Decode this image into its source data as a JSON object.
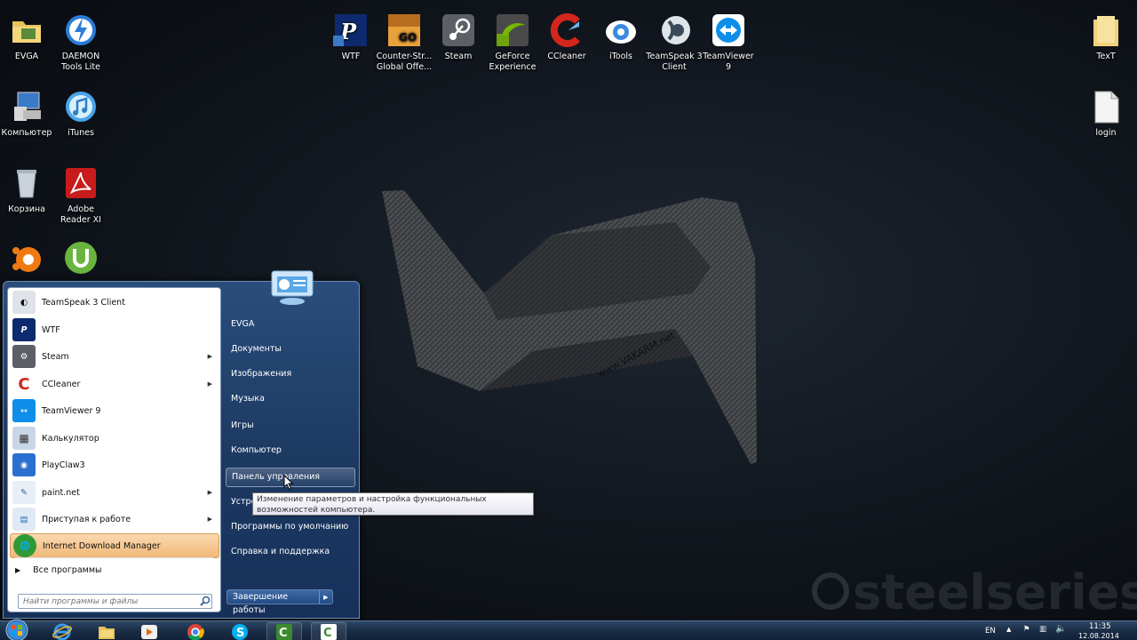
{
  "desktop_icons": [
    {
      "label": "EVGA",
      "icon": "folder-icon"
    },
    {
      "label": "DAEMON Tools Lite",
      "icon": "daemon-tools-icon"
    },
    {
      "label": "Компьютер",
      "icon": "computer-icon"
    },
    {
      "label": "iTunes",
      "icon": "itunes-icon"
    },
    {
      "label": "Корзина",
      "icon": "recycle-bin-icon"
    },
    {
      "label": "Adobe Reader XI",
      "icon": "adobe-reader-icon"
    },
    {
      "label": "WTF",
      "icon": "playclaw-icon"
    },
    {
      "label": "Counter-Str... Global Offe...",
      "icon": "csgo-icon"
    },
    {
      "label": "Steam",
      "icon": "steam-icon"
    },
    {
      "label": "GeForce Experience",
      "icon": "geforce-icon"
    },
    {
      "label": "CCleaner",
      "icon": "ccleaner-icon"
    },
    {
      "label": "iTools",
      "icon": "itools-icon"
    },
    {
      "label": "TeamSpeak 3 Client",
      "icon": "teamspeak-icon"
    },
    {
      "label": "TeamViewer 9",
      "icon": "teamviewer-icon"
    },
    {
      "label": "TexT",
      "icon": "folder-icon"
    },
    {
      "label": "login",
      "icon": "text-file-icon"
    }
  ],
  "start_menu": {
    "programs": [
      {
        "label": "TeamSpeak 3 Client",
        "icon": "teamspeak-icon",
        "has_submenu": false
      },
      {
        "label": "WTF",
        "icon": "playclaw-icon",
        "has_submenu": false
      },
      {
        "label": "Steam",
        "icon": "steam-icon",
        "has_submenu": true
      },
      {
        "label": "CCleaner",
        "icon": "ccleaner-icon",
        "has_submenu": true
      },
      {
        "label": "TeamViewer 9",
        "icon": "teamviewer-icon",
        "has_submenu": false
      },
      {
        "label": "Калькулятор",
        "icon": "calculator-icon",
        "has_submenu": false
      },
      {
        "label": "PlayClaw3",
        "icon": "playclaw3-icon",
        "has_submenu": false
      },
      {
        "label": "paint.net",
        "icon": "paintnet-icon",
        "has_submenu": true
      },
      {
        "label": "Приступая к работе",
        "icon": "getting-started-icon",
        "has_submenu": true
      },
      {
        "label": "Internet Download Manager",
        "icon": "idm-icon",
        "has_submenu": false
      }
    ],
    "all_programs": "Все программы",
    "search_placeholder": "Найти программы и файлы",
    "right_items": [
      {
        "label": "EVGA"
      },
      {
        "label": "Документы"
      },
      {
        "label": "Изображения"
      },
      {
        "label": "Музыка"
      },
      {
        "label": "Игры"
      },
      {
        "label": "Компьютер"
      },
      {
        "label": "Панель управления"
      },
      {
        "label": "Устро"
      },
      {
        "label": "Программы по умолчанию"
      },
      {
        "label": "Справка и поддержка"
      }
    ],
    "shutdown_label": "Завершение работы"
  },
  "tooltip": "Изменение параметров и настройка функциональных возможностей компьютера.",
  "wallpaper": {
    "watermark": "www.VAKARM.net",
    "brand": "steelseries"
  },
  "taskbar": {
    "apps": [
      "internet-explorer-icon",
      "explorer-icon",
      "media-player-icon",
      "chrome-icon",
      "skype-icon",
      "camtasia-icon",
      "camtasia-recorder-icon"
    ],
    "language": "EN",
    "time": "11:35",
    "date": "12.08.2014"
  },
  "colors": {
    "highlight": "#f1b877",
    "menu_blue": "#1d3a63"
  }
}
